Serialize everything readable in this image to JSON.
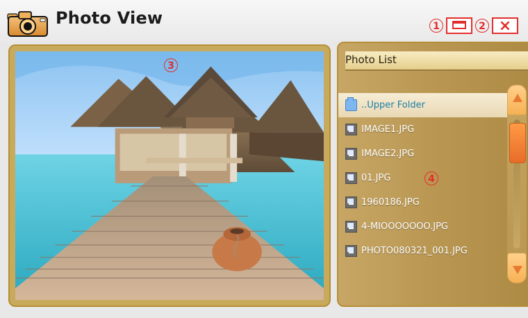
{
  "app": {
    "title": "Photo View"
  },
  "markers": {
    "m1": "1",
    "m2": "2",
    "m3": "3",
    "m4": "4"
  },
  "window_controls": {
    "maximize_icon": "window-maximize-icon",
    "close_glyph": "×"
  },
  "photo_list": {
    "header": "Photo List",
    "items": [
      "..Upper Folder",
      "IMAGE1.JPG",
      "IMAGE2.JPG",
      "01.JPG",
      "1960186.JPG",
      "4-MIOOOOOOO.JPG",
      "PHOTO080321_001.JPG"
    ],
    "selected_index": 0
  },
  "colors": {
    "accent_red": "#e32d2d",
    "gold": "#c8aa5d",
    "selected_text": "#1b7ea4"
  }
}
